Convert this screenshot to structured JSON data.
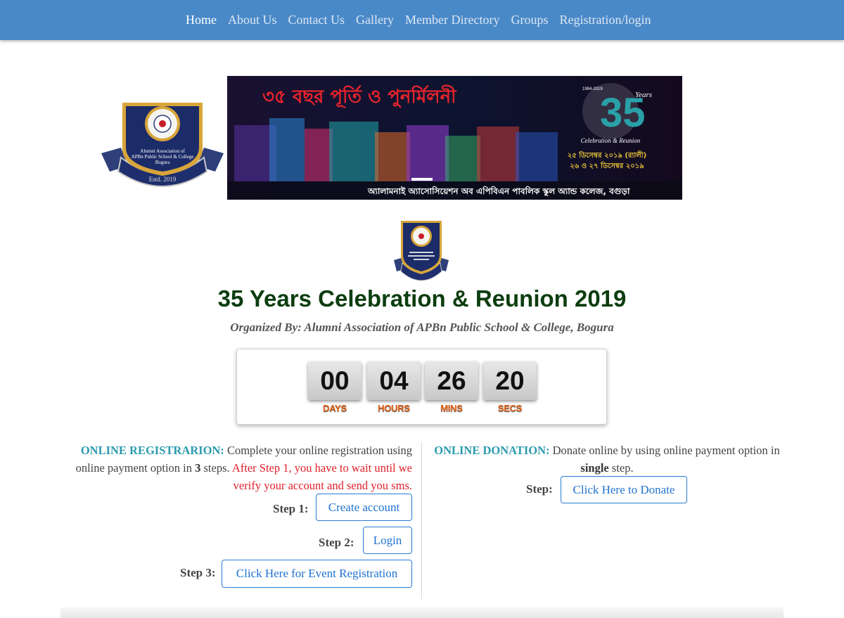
{
  "nav": {
    "items": [
      "Home",
      "About Us",
      "Contact Us",
      "Gallery",
      "Member Directory",
      "Groups",
      "Registration/login"
    ]
  },
  "crest": {
    "text_line1": "Alumni Association of",
    "text_line2": "APBn Public School & College",
    "text_line3": "Bogura",
    "estd": "Estd. 2019"
  },
  "banner": {
    "headline_bn": "৩৫ বছর পূর্তি ও পুনর্মিলনী",
    "years_badge": "Years",
    "badge_range": "1984-2019",
    "celebration": "Celebration & Reunion",
    "date1_bn": "২৫ ডিসেম্বর ২০১৯ (র‍্যালী)",
    "date2_bn": "২৬ ও ২৭ ডিসেম্বর ২০১৯",
    "footer_bn": "অ্যালামনাই অ্যাসোসিয়েশন অব এপিবিএন পাবলিক স্কুল অ্যান্ড কলেজ, বগুড়া"
  },
  "page": {
    "title": "35 Years Celebration & Reunion 2019",
    "subtitle": "Organized By: Alumni Association of APBn Public School & College, Bogura"
  },
  "countdown": {
    "days": "00",
    "hours": "04",
    "mins": "26",
    "secs": "20",
    "days_label": "DAYS",
    "hours_label": "HOURS",
    "mins_label": "MINS",
    "secs_label": "SECS"
  },
  "registration": {
    "heading": "ONLINE REGISTRARION:",
    "text1": " Complete your online registration using online payment option in ",
    "steps_count": "3",
    "text2": " steps. ",
    "warning": "After Step 1, you have to wait until we verify your account and send you sms.",
    "step1_label": "Step 1:",
    "step1_button": "Create account",
    "step2_label": "Step 2:",
    "step2_button": "Login",
    "step3_label": "Step 3:",
    "step3_button": "Click Here for Event Registration"
  },
  "donation": {
    "heading": "ONLINE DONATION:",
    "text1": " Donate online by using online payment option in ",
    "single": "single",
    "text2": " step.",
    "step_label": "Step:",
    "button": "Click Here to Donate"
  },
  "colors": {
    "nav_bg": "#4a89c8",
    "title": "#0c3d0f",
    "heading_teal": "#2a9aae",
    "warning_red": "#e0202a",
    "button_blue": "#1f72cf",
    "countdown_label": "#e8661a"
  }
}
